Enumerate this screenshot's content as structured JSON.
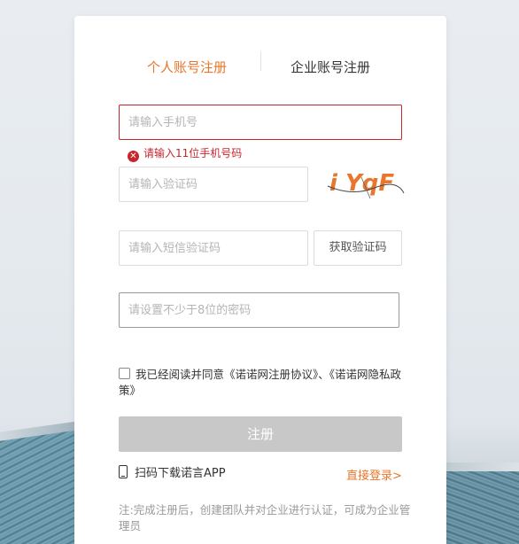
{
  "tabs": {
    "personal": "个人账号注册",
    "enterprise": "企业账号注册"
  },
  "form": {
    "phone_placeholder": "请输入手机号",
    "phone_error": "请输入11位手机号码",
    "captcha_placeholder": "请输入验证码",
    "captcha_text": "i YqF",
    "sms_placeholder": "请输入短信验证码",
    "sms_button": "获取验证码",
    "password_placeholder": "请设置不少于8位的密码"
  },
  "agreement": {
    "text": "我已经阅读并同意《诺诺网注册协议》、《诺诺网隐私政策》",
    "checked": false
  },
  "register_button": "注册",
  "footer": {
    "app_download": "扫码下载诺言APP",
    "login_link": "直接登录>",
    "note": "注:完成注册后，创建团队并对企业进行认证，可成为企业管理员"
  },
  "colors": {
    "accent": "#e9762b",
    "error": "#c7262c",
    "button_disabled": "#c8c8c8"
  },
  "icons": {
    "error": "error-circle-icon",
    "phone": "mobile-phone-icon"
  }
}
